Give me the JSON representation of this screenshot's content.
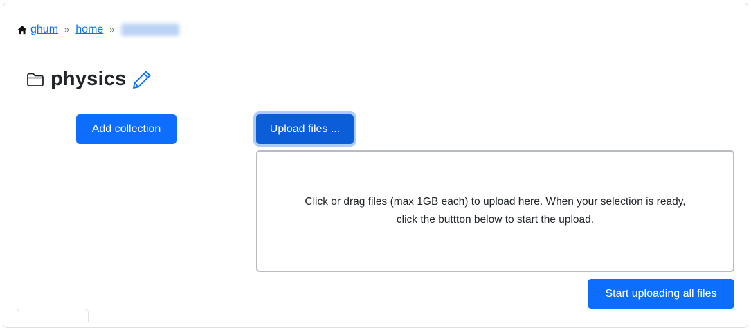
{
  "breadcrumb": {
    "home_label": "ghum",
    "separator": "»",
    "second_label": "home",
    "third_label_redacted": ""
  },
  "folder": {
    "name": "physics"
  },
  "buttons": {
    "add_collection": "Add collection",
    "upload_files": "Upload files ...",
    "start_uploading": "Start uploading all files"
  },
  "dropzone": {
    "line1": "Click or drag files (max 1GB each) to upload here. When your selection is ready,",
    "line2": "click the buttton below to start the upload."
  },
  "colors": {
    "primary": "#0d6efd",
    "primary_active": "#0b5ed7",
    "text": "#212529",
    "border": "#dee2e6"
  },
  "icons": [
    "home-icon",
    "folder-icon",
    "pencil-icon"
  ]
}
